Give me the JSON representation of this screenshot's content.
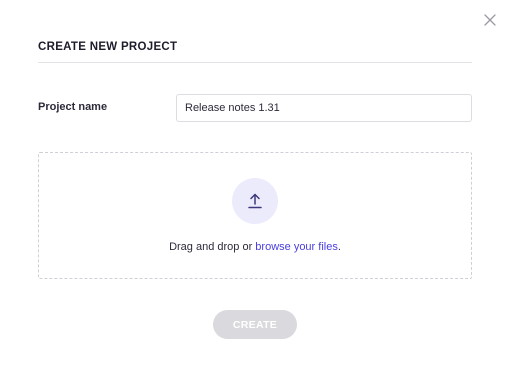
{
  "dialog": {
    "title": "CREATE NEW PROJECT",
    "close_icon": "close-icon"
  },
  "form": {
    "project_name_label": "Project name",
    "project_name_value": "Release notes 1.31"
  },
  "dropzone": {
    "icon": "upload-icon",
    "text_prefix": "Drag and drop or ",
    "link_text": "browse your files",
    "text_suffix": "."
  },
  "actions": {
    "create_label": "CREATE",
    "create_disabled": true
  },
  "colors": {
    "accent": "#4a3ee0",
    "icon_circle_bg": "#ecebfb",
    "disabled_button_bg": "#d9d9de"
  }
}
